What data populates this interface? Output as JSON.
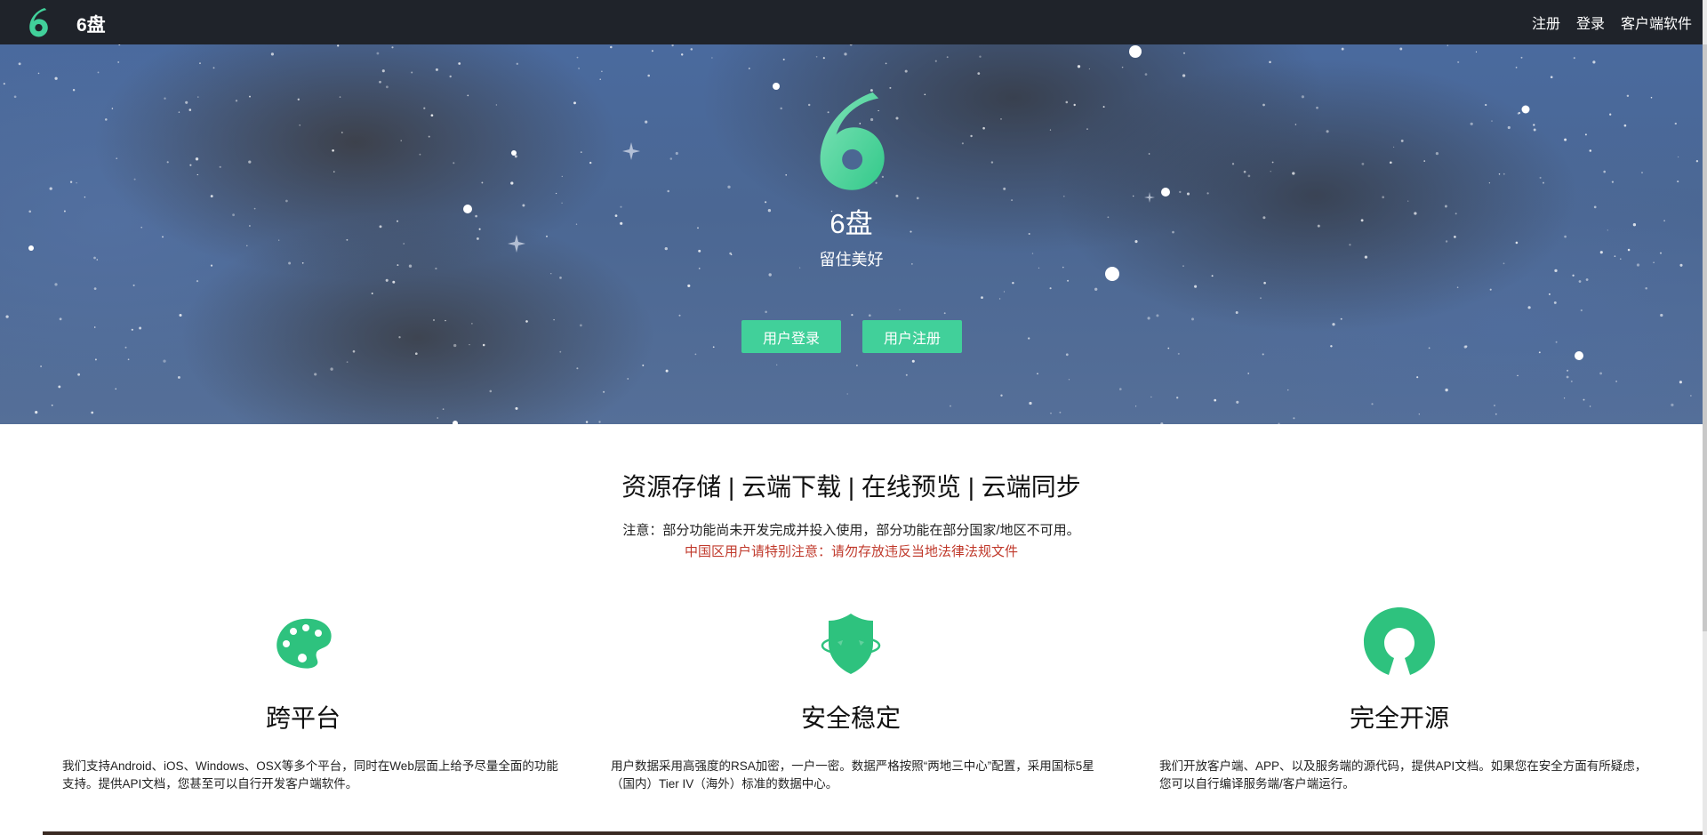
{
  "navbar": {
    "brand": "6盘",
    "links": [
      "注册",
      "登录",
      "客户端软件"
    ]
  },
  "hero": {
    "title": "6盘",
    "subtitle": "留住美好",
    "login_button": "用户登录",
    "register_button": "用户注册"
  },
  "features": {
    "heading": "资源存储 | 云端下载 | 在线预览 | 云端同步",
    "notice": "注意：部分功能尚未开发完成并投入使用，部分功能在部分国家/地区不可用。",
    "notice_cn": "中国区用户请特别注意：请勿存放违反当地法律法规文件",
    "items": [
      {
        "icon": "palette-icon",
        "title": "跨平台",
        "desc": "我们支持Android、iOS、Windows、OSX等多个平台，同时在Web层面上给予尽量全面的功能支持。提供API文档，您甚至可以自行开发客户端软件。"
      },
      {
        "icon": "shield-icon",
        "title": "安全稳定",
        "desc": "用户数据采用高强度的RSA加密，一户一密。数据严格按照“两地三中心”配置，采用国标5星（国内）Tier IV（海外）标准的数据中心。"
      },
      {
        "icon": "open-source-icon",
        "title": "完全开源",
        "desc": "我们开放客户端、APP、以及服务端的源代码，提供API文档。如果您在安全方面有所疑虑，您可以自行编译服务端/客户端运行。"
      }
    ]
  },
  "colors": {
    "accent": "#41d09a",
    "icon_green": "#2ec27e",
    "navbar_bg": "#1f232a",
    "warning_red": "#c0392b"
  }
}
